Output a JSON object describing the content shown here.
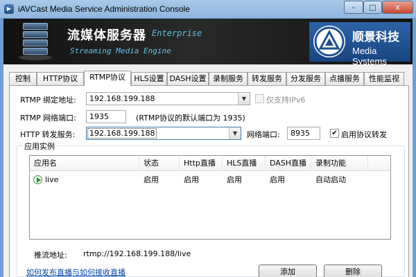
{
  "window": {
    "title": "iAVCast Media Service Administration Console",
    "minimize": "–",
    "maximize": "□",
    "close": "x"
  },
  "banner": {
    "product_cn": "流媒体服务器",
    "edition": "Enterprise",
    "product_en": "Streaming Media Engine",
    "company_cn": "顺景科技",
    "company_en": "Media Systems"
  },
  "tabs": [
    {
      "label": "控制"
    },
    {
      "label": "HTTP协议"
    },
    {
      "label": "RTMP协议",
      "active": true
    },
    {
      "label": "HLS设置"
    },
    {
      "label": "DASH设置"
    },
    {
      "label": "录制服务"
    },
    {
      "label": "转发服务"
    },
    {
      "label": "分发服务"
    },
    {
      "label": "点播服务"
    },
    {
      "label": "性能监视"
    }
  ],
  "form": {
    "bind_label": "RTMP 绑定地址:",
    "bind_value": "192.168.199.188",
    "ipv6_label": "仅支持IPv6",
    "port_label": "RTMP 网络端口:",
    "port_value": "1935",
    "port_hint": "(RTMP协议的默认端口为 1935)",
    "http_forward_label": "HTTP 转发服务:",
    "http_forward_value": "192.168.199.188",
    "net_port_label": "网络端口:",
    "net_port_value": "8935",
    "enable_forward_label": "启用协议转发",
    "check_mark": "✔"
  },
  "instances": {
    "group_title": "应用实例",
    "columns": [
      "应用名",
      "状态",
      "Http直播",
      "HLS直播",
      "DASH直播",
      "录制功能"
    ],
    "rows": [
      {
        "name": "live",
        "status": "启用",
        "http": "启用",
        "hls": "启用",
        "dash": "启用",
        "record": "自动启动"
      }
    ],
    "push_label": "推流地址:",
    "push_value": "rtmp://192.168.199.188/live",
    "help_link": "如何发布直播与如何接收直播",
    "add_button": "添加",
    "delete_button": "删除"
  }
}
